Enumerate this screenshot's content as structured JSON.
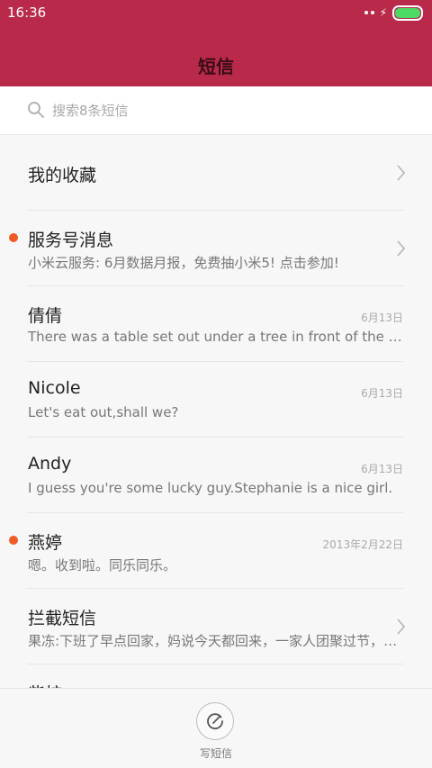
{
  "status_bar": {
    "time": "16:36"
  },
  "header": {
    "title": "短信"
  },
  "search": {
    "placeholder": "搜索8条短信"
  },
  "favorites": {
    "label": "我的收藏"
  },
  "conversations": [
    {
      "name": "服务号消息",
      "preview": "小米云服务: 6月数据月报，免费抽小米5! 点击参加!",
      "date": "",
      "unread": true,
      "chevron": true
    },
    {
      "name": "倩倩",
      "preview": "There was a table set out under a tree in front of the house, and the March Hare and the Hatter were having tea at it",
      "date": "6月13日",
      "unread": false,
      "chevron": false
    },
    {
      "name": "Nicole",
      "preview": "Let's eat out,shall we?",
      "date": "6月13日",
      "unread": false,
      "chevron": false
    },
    {
      "name": "Andy",
      "preview": "I guess you're some lucky guy.Stephanie is a nice girl.",
      "date": "6月13日",
      "unread": false,
      "chevron": false
    },
    {
      "name": "燕婷",
      "preview": "嗯。收到啦。同乐同乐。",
      "date": "2013年2月22日",
      "unread": true,
      "chevron": false
    },
    {
      "name": "拦截短信",
      "preview": "果冻:下班了早点回家，妈说今天都回来，一家人团聚过节，吃顿团圆饭",
      "date": "",
      "unread": false,
      "chevron": true
    },
    {
      "name": "柴核",
      "preview": "",
      "date": "",
      "unread": false,
      "chevron": false
    }
  ],
  "bottom_bar": {
    "compose_label": "写短信"
  },
  "colors": {
    "header_bg": "#b9294a",
    "unread_dot": "#f05a24",
    "battery": "#4cd964"
  }
}
